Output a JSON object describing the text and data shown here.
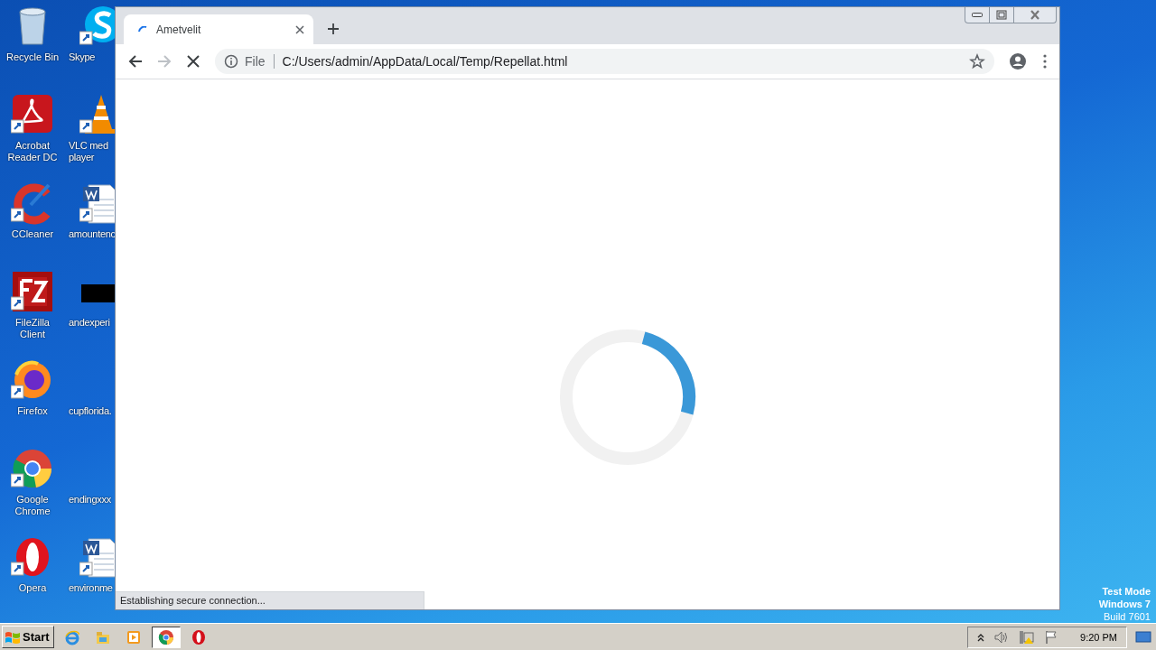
{
  "desktop": {
    "icon_columns": [
      [
        {
          "label": "Recycle Bin"
        },
        {
          "label": "Acrobat Reader DC"
        },
        {
          "label": "CCleaner"
        },
        {
          "label": "FileZilla Client"
        },
        {
          "label": "Firefox"
        },
        {
          "label": "Google Chrome"
        },
        {
          "label": "Opera"
        }
      ],
      [
        {
          "label": "Skype"
        },
        {
          "label": "VLC med player"
        },
        {
          "label": "amountenc"
        },
        {
          "label": "andexperi"
        },
        {
          "label": "cupflorida."
        },
        {
          "label": "endingxxx"
        },
        {
          "label": "environme"
        }
      ]
    ],
    "os_notice": [
      "Test Mode",
      "Windows 7",
      "Build 7601"
    ]
  },
  "browser": {
    "tabs": [
      {
        "title": "Ametvelit",
        "selected": true,
        "loading": true
      }
    ],
    "address": {
      "scheme": "File",
      "url": "C:/Users/admin/AppData/Local/Temp/Repellat.html"
    },
    "loading": true,
    "status": "Establishing secure connection..."
  },
  "taskbar": {
    "start": "Start",
    "apps": [
      {
        "selected": false
      },
      {
        "selected": false
      },
      {
        "selected": false
      },
      {
        "selected": true
      },
      {
        "selected": false
      }
    ],
    "clock": "9:20 PM"
  }
}
